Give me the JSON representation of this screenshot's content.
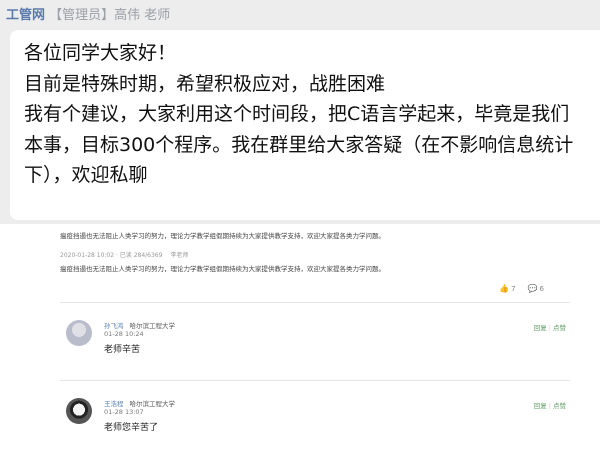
{
  "chat": {
    "sender_prefix": "",
    "watermark": "工管网",
    "sender_name": "【管理员】高伟 老师",
    "message_lines": [
      "各位同学大家好！",
      "目前是特殊时期，希望积极应对，战胜困难",
      "我有个建议，大家利用这个时间段，把C语言学起来，毕竟是我们",
      "本事，目标300个程序。我在群里给大家答疑（在不影响信息统计",
      "下），欢迎私聊"
    ]
  },
  "post": {
    "text1": "瘟疫挡遏也无法阻止人类学习的努力，理论力学教学组假期持续为大家提供教学支持，欢迎大家提各类力学问题。",
    "date_line": "2020-01-28 10:02 · 已读 284/6369",
    "author_hint": "李老师",
    "text2": "瘟疫挡遏也无法阻止人类学习的努力，理论力学教学组假期持续为大家提供教学支持，欢迎大家提各类力学问题。",
    "likes": "7",
    "comments_count": "6",
    "like_icon": "thumb-up-icon",
    "comment_icon": "comment-icon"
  },
  "comments": [
    {
      "name": "孙飞鸿",
      "school": "哈尔滨工程大学",
      "time": "01-28 10:24",
      "text": "老师辛苦",
      "reply": "回复",
      "like": "点赞"
    },
    {
      "name": "王浩程",
      "school": "哈尔滨工程大学",
      "time": "01-28 13:07",
      "text": "老师您辛苦了",
      "reply": "回复",
      "like": "点赞"
    }
  ]
}
